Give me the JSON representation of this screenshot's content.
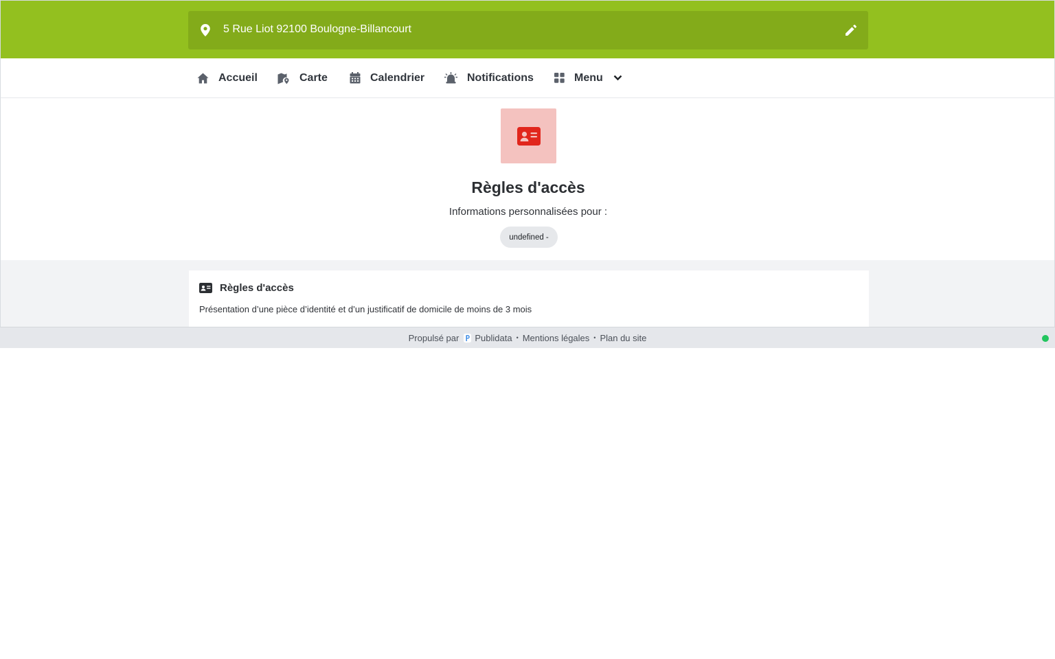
{
  "header": {
    "address": "5 Rue Liot 92100 Boulogne-Billancourt",
    "icons": {
      "location": "map-pin-icon",
      "edit": "pencil-icon"
    }
  },
  "nav": {
    "items": [
      {
        "label": "Accueil",
        "icon": "home-icon"
      },
      {
        "label": "Carte",
        "icon": "map-location-icon"
      },
      {
        "label": "Calendrier",
        "icon": "calendar-icon"
      },
      {
        "label": "Notifications",
        "icon": "alarm-bell-icon"
      },
      {
        "label": "Menu",
        "icon": "grid-icon"
      }
    ]
  },
  "hero": {
    "icon": "id-card-icon",
    "title": "Règles d'accès",
    "subtitle": "Informations personnalisées pour :",
    "chip": "undefined -"
  },
  "card": {
    "icon": "id-card-icon",
    "title": "Règles d'accès",
    "body": "Présentation d’une pièce d’identité et d’un justificatif de domicile de moins de 3 mois"
  },
  "footer": {
    "powered_by": "Propulsé par",
    "brand": "Publidata",
    "legal": "Mentions légales",
    "sitemap": "Plan du site",
    "separator": "•"
  },
  "colors": {
    "header_green": "#93c01f",
    "address_bar_green": "#83ab1a",
    "hero_icon_bg": "#f4c2bf",
    "hero_icon_fg": "#e1261c",
    "status_green": "#22c55e",
    "content_bg": "#f2f3f5"
  }
}
